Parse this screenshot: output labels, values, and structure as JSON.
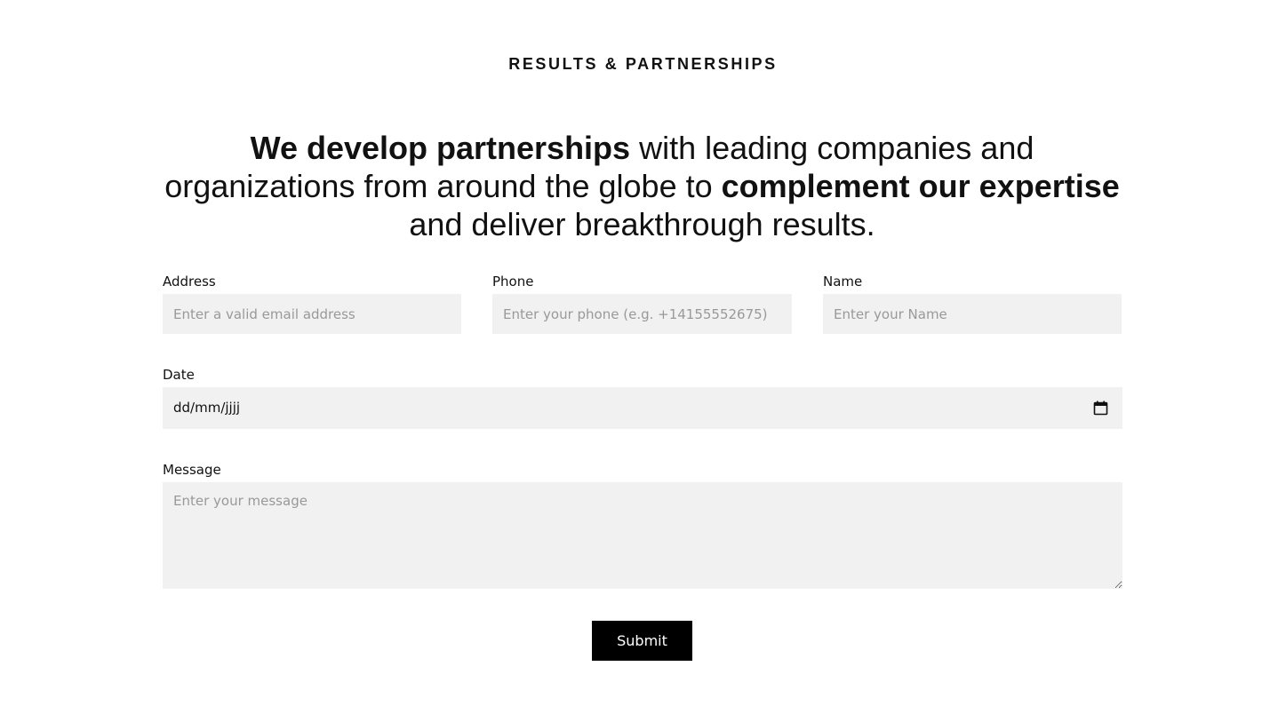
{
  "section": {
    "eyebrow": "RESULTS & PARTNERSHIPS",
    "headline": {
      "part1_bold": "We develop partnerships",
      "part2": " with leading companies and organizations from around the globe to ",
      "part3_bold": "complement our expertise",
      "part4": " and deliver breakthrough results."
    }
  },
  "form": {
    "address": {
      "label": "Address",
      "placeholder": "Enter a valid email address"
    },
    "phone": {
      "label": "Phone",
      "placeholder": "Enter your phone (e.g. +14155552675)"
    },
    "name": {
      "label": "Name",
      "placeholder": "Enter your Name"
    },
    "date": {
      "label": "Date",
      "value": "dd/mm/jjjj",
      "icon": "calendar-icon"
    },
    "message": {
      "label": "Message",
      "placeholder": "Enter your message"
    },
    "submit_label": "Submit"
  },
  "colors": {
    "field_background": "#f1f1f1",
    "button_background": "#000000",
    "button_text": "#ffffff",
    "placeholder": "#999999"
  }
}
